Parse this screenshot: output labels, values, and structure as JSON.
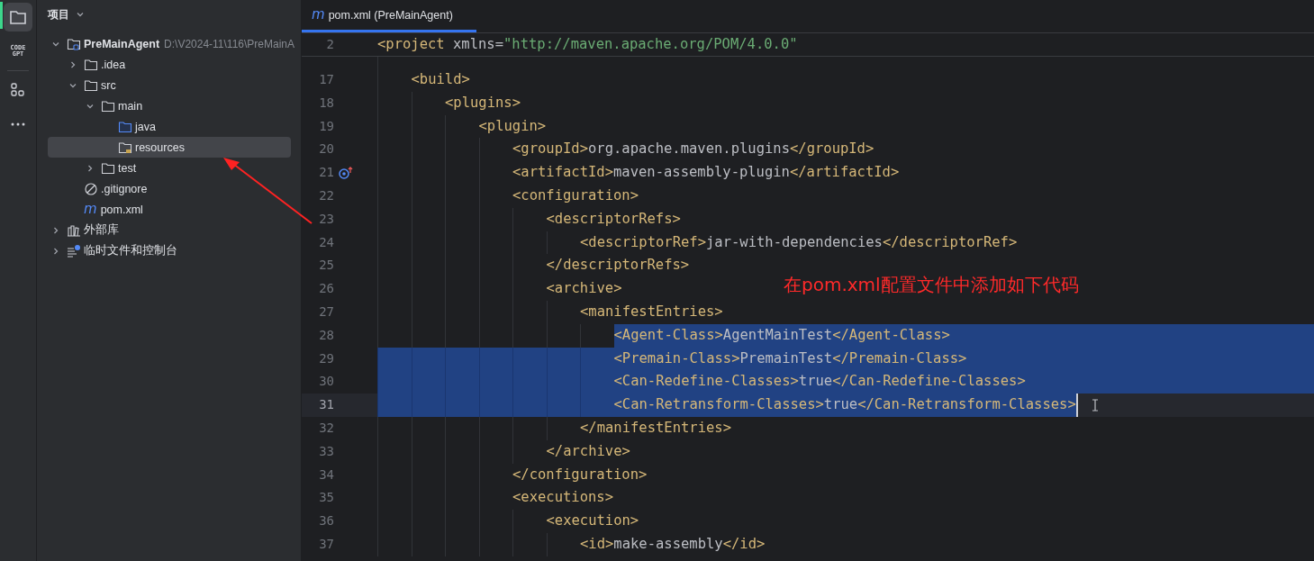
{
  "activity_bar": [
    {
      "kind": "folder",
      "selected": true
    },
    {
      "kind": "codegpt",
      "label": "CODE GPT",
      "selected": false
    },
    {
      "kind": "divider"
    },
    {
      "kind": "structure",
      "selected": false
    },
    {
      "kind": "more",
      "selected": false
    }
  ],
  "project_panel": {
    "title": "项目",
    "tree": [
      {
        "label": "PreMainAgent",
        "path": "D:\\V2024-11\\116\\PreMainA",
        "kind": "project",
        "expanded": true,
        "selected": false,
        "children": [
          {
            "label": ".idea",
            "kind": "folder",
            "expanded": false,
            "selected": false
          },
          {
            "label": "src",
            "kind": "folder",
            "expanded": true,
            "selected": false,
            "children": [
              {
                "label": "main",
                "kind": "folder",
                "expanded": true,
                "selected": false,
                "children": [
                  {
                    "label": "java",
                    "kind": "source",
                    "selected": false
                  },
                  {
                    "label": "resources",
                    "kind": "resources",
                    "selected": true
                  }
                ]
              },
              {
                "label": "test",
                "kind": "folder",
                "expanded": false,
                "selected": false
              }
            ]
          },
          {
            "label": ".gitignore",
            "kind": "ignore",
            "selected": false
          },
          {
            "label": "pom.xml",
            "kind": "maven",
            "icon": "m",
            "selected": false
          }
        ]
      },
      {
        "label": "外部库",
        "kind": "library",
        "expanded": false,
        "selected": false
      },
      {
        "label": "临时文件和控制台",
        "kind": "scratches",
        "expanded": false,
        "selected": false
      }
    ]
  },
  "tabs": [
    {
      "label": "pom.xml (PreMainAgent)",
      "kind": "maven",
      "icon": "m",
      "selected": true
    }
  ],
  "sticky_line": {
    "number": "2",
    "tokens": [
      {
        "kind": "tag",
        "text": "<project"
      },
      {
        "kind": "text",
        "text": " xmlns="
      },
      {
        "kind": "string",
        "text": "\"http://maven.apache.org/POM/4.0.0\""
      }
    ],
    "children": [
      {
        "number": "17",
        "selected": false,
        "tokens": [
          {
            "kind": "tag",
            "text": "<build>"
          }
        ],
        "children": [
          {
            "number": "18",
            "selected": false,
            "tokens": [
              {
                "kind": "tag",
                "text": "<plugins>"
              }
            ],
            "children": [
              {
                "number": "19",
                "selected": false,
                "tokens": [
                  {
                    "kind": "tag",
                    "text": "<plugin>"
                  }
                ],
                "children": [
                  {
                    "number": "20",
                    "selected": false,
                    "tokens": [
                      {
                        "kind": "tag",
                        "text": "<groupId>"
                      },
                      {
                        "kind": "text",
                        "text": "org.apache.maven.plugins"
                      },
                      {
                        "kind": "tag",
                        "text": "</groupId>"
                      }
                    ]
                  },
                  {
                    "number": "21",
                    "selected": false,
                    "gutter_icon": true,
                    "tokens": [
                      {
                        "kind": "tag",
                        "text": "<artifactId>"
                      },
                      {
                        "kind": "text",
                        "text": "maven-assembly-plugin"
                      },
                      {
                        "kind": "tag",
                        "text": "</artifactId>"
                      }
                    ]
                  },
                  {
                    "number": "22",
                    "selected": false,
                    "tokens": [
                      {
                        "kind": "tag",
                        "text": "<configuration>"
                      }
                    ],
                    "children": [
                      {
                        "number": "23",
                        "selected": false,
                        "tokens": [
                          {
                            "kind": "tag",
                            "text": "<descriptorRefs>"
                          }
                        ],
                        "children": [
                          {
                            "number": "24",
                            "selected": false,
                            "tokens": [
                              {
                                "kind": "tag",
                                "text": "<descriptorRef>"
                              },
                              {
                                "kind": "text",
                                "text": "jar-with-dependencies"
                              },
                              {
                                "kind": "tag",
                                "text": "</descriptorRef>"
                              }
                            ]
                          }
                        ]
                      },
                      {
                        "number": "25",
                        "selected": false,
                        "tokens": [
                          {
                            "kind": "tag",
                            "text": "</descriptorRefs>"
                          }
                        ]
                      },
                      {
                        "number": "26",
                        "selected": false,
                        "tokens": [
                          {
                            "kind": "tag",
                            "text": "<archive>"
                          }
                        ],
                        "children": [
                          {
                            "number": "27",
                            "selected": false,
                            "tokens": [
                              {
                                "kind": "tag",
                                "text": "<manifestEntries>"
                              }
                            ],
                            "children": [
                              {
                                "number": "28",
                                "selected": true,
                                "selection_start": true,
                                "tokens": [
                                  {
                                    "kind": "tag",
                                    "text": "<Agent-Class>"
                                  },
                                  {
                                    "kind": "text",
                                    "text": "AgentMainTest"
                                  },
                                  {
                                    "kind": "tag",
                                    "text": "</Agent-Class>"
                                  }
                                ]
                              },
                              {
                                "number": "29",
                                "selected": true,
                                "tokens": [
                                  {
                                    "kind": "tag",
                                    "text": "<Premain-Class>"
                                  },
                                  {
                                    "kind": "text",
                                    "text": "PremainTest"
                                  },
                                  {
                                    "kind": "tag",
                                    "text": "</Premain-Class>"
                                  }
                                ]
                              },
                              {
                                "number": "30",
                                "selected": true,
                                "tokens": [
                                  {
                                    "kind": "tag",
                                    "text": "<Can-Redefine-Classes>"
                                  },
                                  {
                                    "kind": "text",
                                    "text": "true"
                                  },
                                  {
                                    "kind": "tag",
                                    "text": "</Can-Redefine-Classes>"
                                  }
                                ]
                              },
                              {
                                "number": "31",
                                "selected": true,
                                "caret": true,
                                "current": true,
                                "tokens": [
                                  {
                                    "kind": "tag",
                                    "text": "<Can-Retransform-Classes>"
                                  },
                                  {
                                    "kind": "text",
                                    "text": "true"
                                  },
                                  {
                                    "kind": "tag",
                                    "text": "</Can-Retransform-Classes>"
                                  }
                                ]
                              }
                            ]
                          },
                          {
                            "number": "32",
                            "selected": false,
                            "tokens": [
                              {
                                "kind": "tag",
                                "text": "</manifestEntries>"
                              }
                            ]
                          }
                        ]
                      },
                      {
                        "number": "33",
                        "selected": false,
                        "tokens": [
                          {
                            "kind": "tag",
                            "text": "</archive>"
                          }
                        ]
                      }
                    ]
                  },
                  {
                    "number": "34",
                    "selected": false,
                    "tokens": [
                      {
                        "kind": "tag",
                        "text": "</configuration>"
                      }
                    ]
                  },
                  {
                    "number": "35",
                    "selected": false,
                    "tokens": [
                      {
                        "kind": "tag",
                        "text": "<executions>"
                      }
                    ],
                    "children": [
                      {
                        "number": "36",
                        "selected": false,
                        "tokens": [
                          {
                            "kind": "tag",
                            "text": "<execution>"
                          }
                        ],
                        "children": [
                          {
                            "number": "37",
                            "selected": false,
                            "tokens": [
                              {
                                "kind": "tag",
                                "text": "<id>"
                              },
                              {
                                "kind": "text",
                                "text": "make-assembly"
                              },
                              {
                                "kind": "tag",
                                "text": "</id>"
                              }
                            ]
                          }
                        ]
                      }
                    ]
                  }
                ]
              }
            ]
          }
        ]
      }
    ]
  },
  "annotation": {
    "text": "在pom.xml配置文件中添加如下代码"
  }
}
